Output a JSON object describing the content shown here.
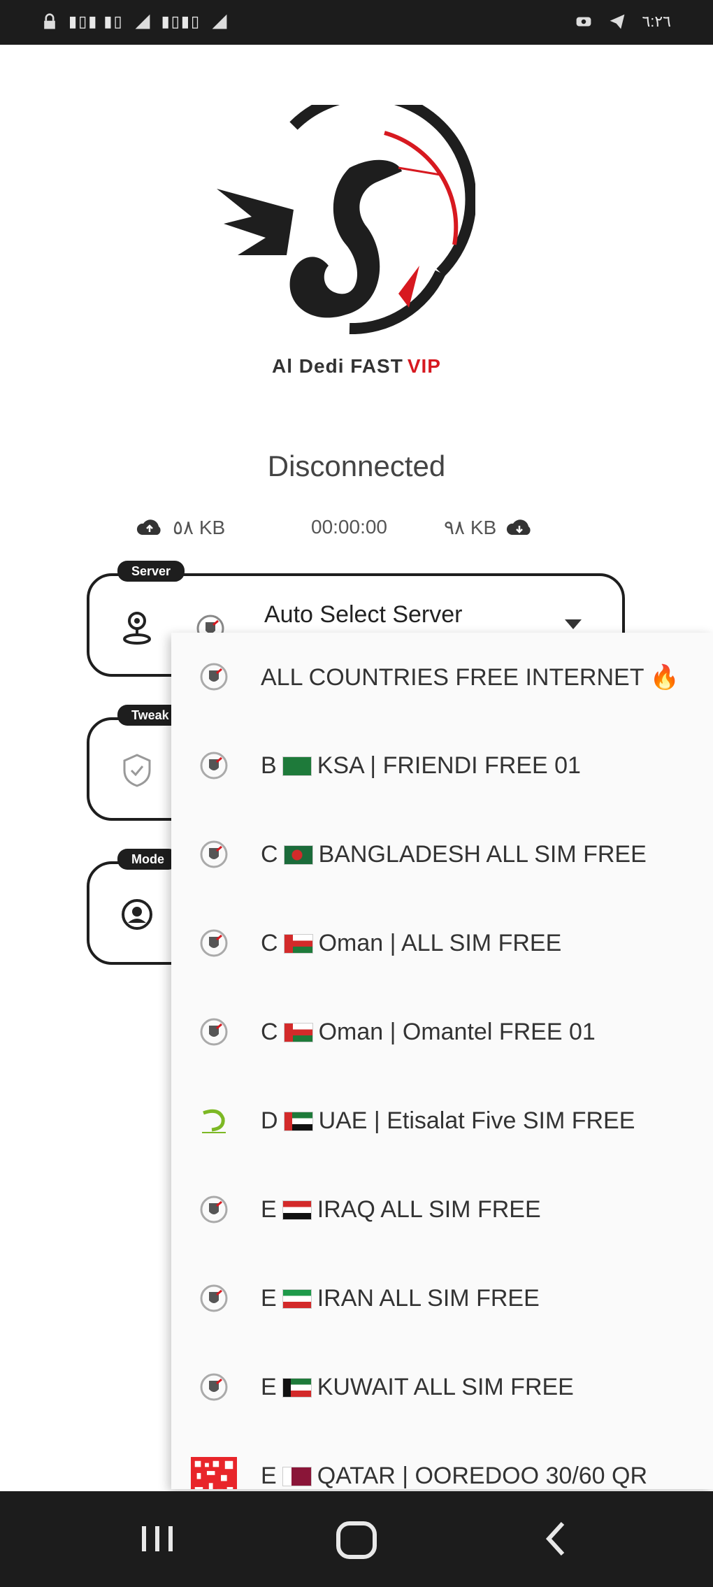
{
  "status_bar": {
    "left_text": "□ ⚙จใ ◣ ⊕ ≡ ◣",
    "time": "٦:٢٦"
  },
  "app": {
    "name": "Al Dedi FAST",
    "name_suffix": "VIP"
  },
  "connection": {
    "status": "Disconnected",
    "upload": "٥٨ KB",
    "timer": "00:00:00",
    "download": "٩٨ KB"
  },
  "cards": [
    {
      "tag": "Server",
      "title": "Auto Select Server"
    },
    {
      "tag": "Tweak",
      "title": ""
    },
    {
      "tag": "Mode",
      "title": ""
    }
  ],
  "dropdown": {
    "options": [
      {
        "label": "ALL COUNTRIES FREE INTERNET",
        "emoji": "🔥",
        "icon": "shield-icon",
        "flag": ""
      },
      {
        "label_prefix": "B",
        "flag": "ksa",
        "label": "KSA | FRIENDI FREE 01",
        "icon": "shield-icon"
      },
      {
        "label_prefix": "C",
        "flag": "bangladesh",
        "label": "BANGLADESH ALL SIM FREE",
        "icon": "shield-icon"
      },
      {
        "label_prefix": "C",
        "flag": "oman",
        "label": "Oman | ALL SIM FREE",
        "icon": "shield-icon"
      },
      {
        "label_prefix": "C",
        "flag": "oman",
        "label": "Oman | Omantel FREE 01",
        "icon": "shield-icon"
      },
      {
        "label_prefix": "D",
        "flag": "uae",
        "label": "UAE | Etisalat Five SIM FREE",
        "icon": "etisalat-icon"
      },
      {
        "label_prefix": "E",
        "flag": "iraq",
        "label": "IRAQ ALL SIM FREE",
        "icon": "shield-icon"
      },
      {
        "label_prefix": "E",
        "flag": "iran",
        "label": "IRAN ALL SIM FREE",
        "icon": "shield-icon"
      },
      {
        "label_prefix": "E",
        "flag": "kuwait",
        "label": "KUWAIT ALL SIM FREE",
        "icon": "shield-icon"
      },
      {
        "label_prefix": "E",
        "flag": "qatar",
        "label": "QATAR | OOREDOO 30/60 QR",
        "icon": "ooredoo-qr-icon"
      }
    ]
  },
  "colors": {
    "accent": "#d71920",
    "dark": "#1e1e1e"
  }
}
